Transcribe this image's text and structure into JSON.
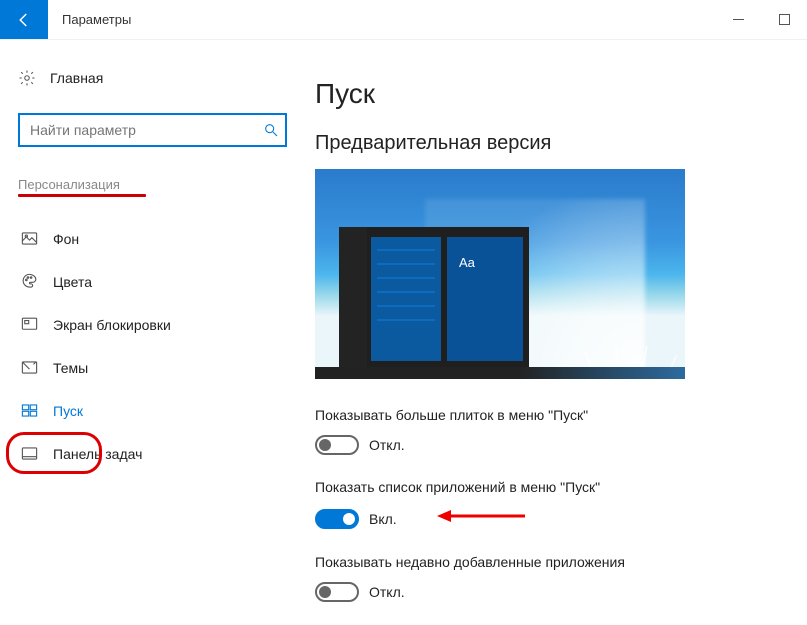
{
  "window": {
    "title": "Параметры"
  },
  "sidebar": {
    "home": "Главная",
    "search_placeholder": "Найти параметр",
    "section": "Персонализация",
    "items": [
      {
        "label": "Фон"
      },
      {
        "label": "Цвета"
      },
      {
        "label": "Экран блокировки"
      },
      {
        "label": "Темы"
      },
      {
        "label": "Пуск"
      },
      {
        "label": "Панель задач"
      }
    ]
  },
  "main": {
    "heading": "Пуск",
    "preview_heading": "Предварительная версия",
    "preview_tile_text": "Aa",
    "toggles": [
      {
        "label": "Показывать больше плиток в меню \"Пуск\"",
        "state": "Откл.",
        "on": false,
        "annotated": false
      },
      {
        "label": "Показать список приложений в меню \"Пуск\"",
        "state": "Вкл.",
        "on": true,
        "annotated": true
      },
      {
        "label": "Показывать недавно добавленные приложения",
        "state": "Откл.",
        "on": false,
        "annotated": false
      }
    ]
  },
  "colors": {
    "accent": "#0078d7",
    "annotation_red": "#d00000"
  }
}
